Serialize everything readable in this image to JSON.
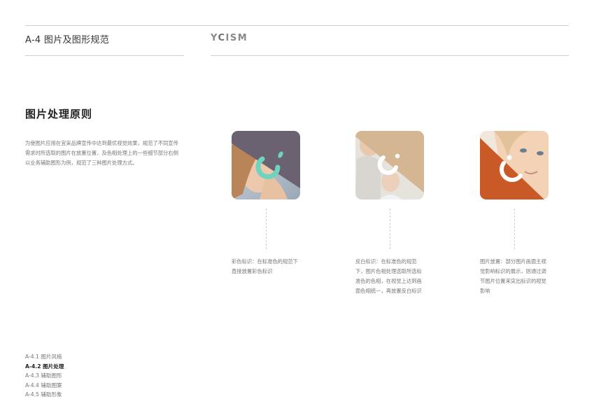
{
  "header": {
    "section_label": "A-4 图片及图形规范",
    "brand_prefix": "Y",
    "brand_c": "C",
    "brand_suffix": "ISM"
  },
  "main": {
    "title": "图片处理原则",
    "intro": "为使图片应用在宜采品牌宣传中达到最优视觉效果，规范了不同宣传需求时所选取的图片在放置位置，及色相处理上的一些细节部分右侧以业务辅助图形为例，规范了三种图片处理方式。"
  },
  "examples": [
    {
      "caption": "彩色标识：在标准色的规范下直接放置彩色标识",
      "overlay_color": "#6b6271",
      "mark_color": "#6fd3be"
    },
    {
      "caption": "反白标识：在标准色的规范下，图片色相处理选取所选标准色的色相，在视觉上达到画面色相统一，再放置反白标识",
      "overlay_color": "#d4b792",
      "mark_color": "#ffffff"
    },
    {
      "caption": "图片放置：部分图片画面主视觉影响标识的展示，则通过调节图片位置来突出标识的视觉影响",
      "overlay_color": "#c95a28",
      "mark_color": "#ffffff"
    }
  ],
  "nav": {
    "items": [
      {
        "label": "A-4.1 图片风格",
        "active": false
      },
      {
        "label": "A-4.2 图片处理",
        "active": true
      },
      {
        "label": "A-4.3 辅助图形",
        "active": false
      },
      {
        "label": "A-4.4 辅助图案",
        "active": false
      },
      {
        "label": "A-4.5 辅助形象",
        "active": false
      }
    ]
  }
}
